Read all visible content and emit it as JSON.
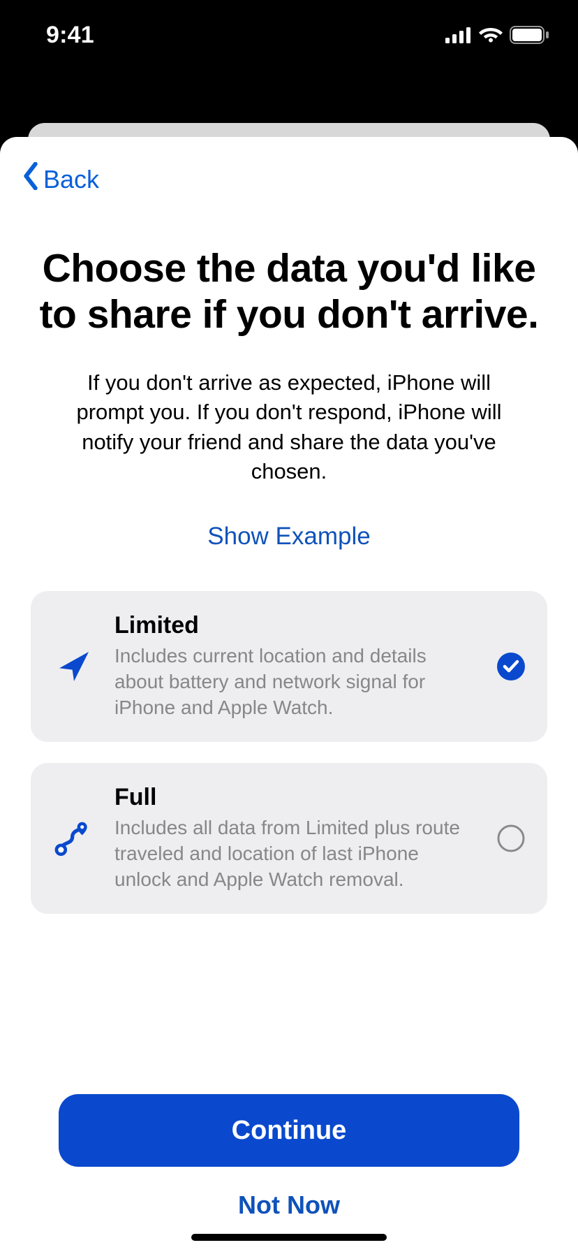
{
  "status": {
    "time": "9:41"
  },
  "nav": {
    "back_label": "Back"
  },
  "header": {
    "title": "Choose the data you'd like to share if you don't arrive.",
    "subtitle": "If you don't arrive as expected, iPhone will prompt you. If you don't respond, iPhone will notify your friend and share the data you've chosen.",
    "example_link": "Show Example"
  },
  "options": [
    {
      "id": "limited",
      "title": "Limited",
      "description": "Includes current location and details about battery and network signal for iPhone and Apple Watch.",
      "selected": true
    },
    {
      "id": "full",
      "title": "Full",
      "description": "Includes all data from Limited plus route traveled and location of last iPhone unlock and Apple Watch removal.",
      "selected": false
    }
  ],
  "footer": {
    "continue_label": "Continue",
    "not_now_label": "Not Now"
  },
  "colors": {
    "accent": "#0A49CE",
    "link": "#0F52BA",
    "card_bg": "#EEEEF0",
    "secondary_text": "#86868B"
  }
}
